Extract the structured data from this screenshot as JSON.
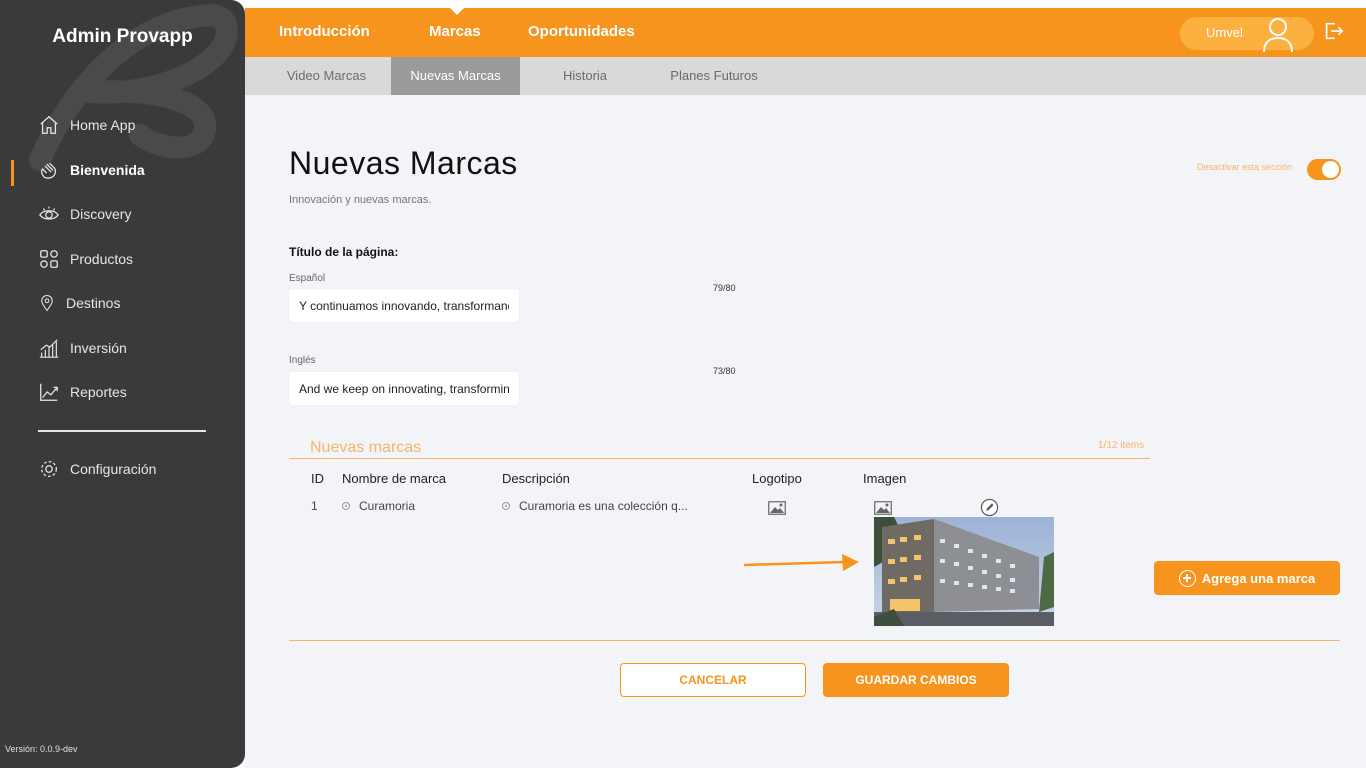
{
  "app": {
    "title": "Admin Provapp",
    "version": "Versión: 0.0.9-dev"
  },
  "sidebar": {
    "items": [
      {
        "label": "Home App",
        "icon": "home-icon"
      },
      {
        "label": "Bienvenida",
        "icon": "waving-hand-icon",
        "active": true
      },
      {
        "label": "Discovery",
        "icon": "eye-icon"
      },
      {
        "label": "Productos",
        "icon": "grid-shapes-icon"
      },
      {
        "label": "Destinos",
        "icon": "map-pin-icon"
      },
      {
        "label": "Inversión",
        "icon": "bar-chart-icon"
      },
      {
        "label": "Reportes",
        "icon": "line-chart-icon"
      }
    ],
    "settings": {
      "label": "Configuración",
      "icon": "gear-icon"
    }
  },
  "topnav": {
    "tabs": [
      {
        "label": "Introducción"
      },
      {
        "label": "Marcas",
        "active": true
      },
      {
        "label": "Oportunidades"
      }
    ],
    "user": {
      "name": "Umvel"
    }
  },
  "subnav": {
    "tabs": [
      {
        "label": "Video Marcas"
      },
      {
        "label": "Nuevas Marcas",
        "active": true
      },
      {
        "label": "Historia"
      },
      {
        "label": "Planes Futuros"
      }
    ]
  },
  "page": {
    "title": "Nuevas Marcas",
    "subtitle": "Innovación y nuevas marcas.",
    "deactivate_label": "Desactivar esta sección",
    "section_enabled": true,
    "section_label": "Título de la página:",
    "spanish": {
      "label": "Español",
      "value": "Y continuamos innovando, transformando",
      "counter": "79/80"
    },
    "english": {
      "label": "Inglés",
      "value": "And we keep on innovating, transforming",
      "counter": "73/80"
    }
  },
  "brands": {
    "title": "Nuevas marcas",
    "count": "1/12 items",
    "columns": [
      "ID",
      "Nombre de marca",
      "Descripción",
      "Logotipo",
      "Imagen"
    ],
    "rows": [
      {
        "id": "1",
        "name": "Curamoria",
        "description": "Curamoria es una colección q..."
      }
    ],
    "add_label": "Agrega una marca"
  },
  "actions": {
    "cancel": "CANCELAR",
    "save": "GUARDAR CAMBIOS"
  },
  "colors": {
    "accent": "#f7941d",
    "sidebar": "#3a3a3a",
    "background": "#f3f4f7"
  }
}
